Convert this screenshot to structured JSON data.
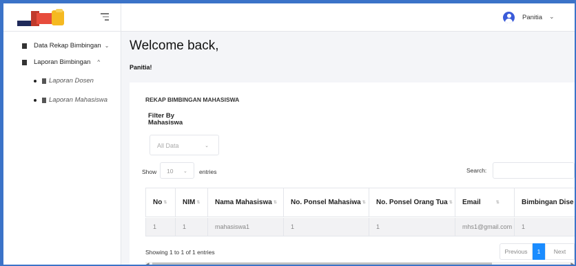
{
  "sidebar": {
    "items": [
      {
        "label": "Data Rekap Bimbingan",
        "chevron": "⌄"
      },
      {
        "label": "Laporan Bimbingan",
        "chevron": "^"
      }
    ],
    "subitems": [
      {
        "label": "Laporan Dosen"
      },
      {
        "label": "Laporan Mahasiswa"
      }
    ]
  },
  "topbar": {
    "user_name": "Panitia",
    "user_chevron": "⌄"
  },
  "header": {
    "title": "Welcome back,",
    "subtitle": "Panitia!"
  },
  "card": {
    "title": "REKAP BIMBINGAN MAHASISWA",
    "filter_label_line1": "Filter By",
    "filter_label_line2": "Mahasiswa",
    "filter_value": "All Data",
    "show_label": "Show",
    "page_length": "10",
    "entries_label": "entries",
    "search_label": "Search:"
  },
  "table": {
    "headers": [
      "No",
      "NIM",
      "Nama Mahasiswa",
      "No. Ponsel Mahasiwa",
      "No. Ponsel Orang Tua",
      "Email",
      "Bimbingan Dise"
    ],
    "rows": [
      [
        "1",
        "1",
        "mahasiswa1",
        "1",
        "1",
        "mhs1@gmail.com",
        "1"
      ]
    ]
  },
  "pagination": {
    "info": "Showing 1 to 1 of 1 entries",
    "previous": "Previous",
    "current": "1",
    "next": "Next"
  },
  "colors": {
    "accent": "#1a8cff",
    "user_icon": "#3a5bd9",
    "outer_border": "#3b73c8"
  }
}
